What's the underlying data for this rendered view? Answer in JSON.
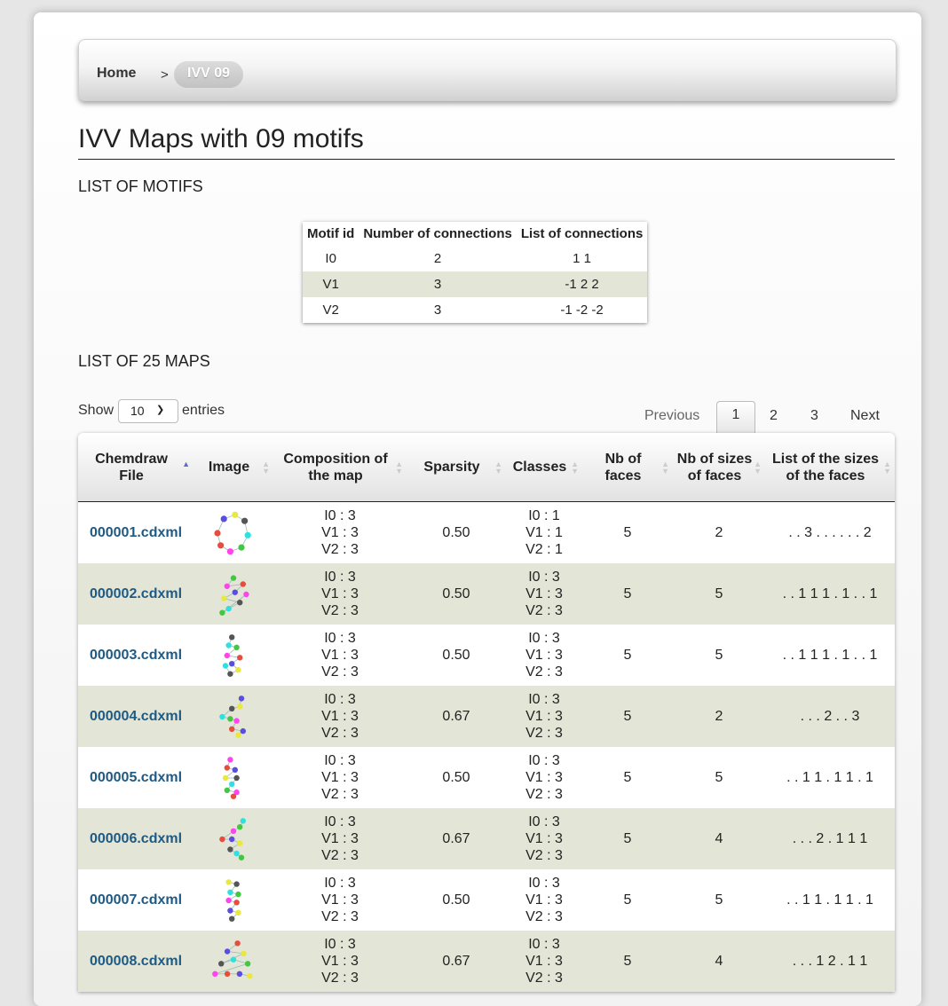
{
  "breadcrumb": {
    "home": "Home",
    "separator": ">",
    "current": "IVV 09"
  },
  "title": "IVV Maps with 09 motifs",
  "motifs_title": "LIST OF MOTIFS",
  "motif_table": {
    "headers": [
      "Motif id",
      "Number of connections",
      "List of connections"
    ],
    "rows": [
      [
        "I0",
        "2",
        "1 1"
      ],
      [
        "V1",
        "3",
        "-1 2 2"
      ],
      [
        "V2",
        "3",
        "-1 -2 -2"
      ]
    ]
  },
  "maps_title": "LIST OF 25 MAPS",
  "length_control": {
    "show": "Show",
    "value": "10",
    "entries": "entries"
  },
  "pagination": {
    "previous": "Previous",
    "pages": [
      "1",
      "2",
      "3"
    ],
    "next": "Next"
  },
  "maps_table": {
    "headers": [
      "Chemdraw File",
      "Image",
      "Composition of the map",
      "Sparsity",
      "Classes",
      "Nb of faces",
      "Nb of sizes of faces",
      "List of the sizes of the faces"
    ],
    "rows": [
      {
        "file": "000001.cdxml",
        "image": "molecule-ring-icon",
        "composition": [
          "I0 : 3",
          "V1 : 3",
          "V2 : 3"
        ],
        "sparsity": "0.50",
        "classes": [
          "I0 : 1",
          "V1 : 1",
          "V2 : 1"
        ],
        "faces": "5",
        "sizes": "2",
        "list": ". . 3 . . . . . . 2"
      },
      {
        "file": "000002.cdxml",
        "image": "molecule-graph-icon",
        "composition": [
          "I0 : 3",
          "V1 : 3",
          "V2 : 3"
        ],
        "sparsity": "0.50",
        "classes": [
          "I0 : 3",
          "V1 : 3",
          "V2 : 3"
        ],
        "faces": "5",
        "sizes": "5",
        "list": ". . 1 1 1 . 1 . . 1"
      },
      {
        "file": "000003.cdxml",
        "image": "molecule-graph-icon",
        "composition": [
          "I0 : 3",
          "V1 : 3",
          "V2 : 3"
        ],
        "sparsity": "0.50",
        "classes": [
          "I0 : 3",
          "V1 : 3",
          "V2 : 3"
        ],
        "faces": "5",
        "sizes": "5",
        "list": ". . 1 1 1 . 1 . . 1"
      },
      {
        "file": "000004.cdxml",
        "image": "molecule-graph-icon",
        "composition": [
          "I0 : 3",
          "V1 : 3",
          "V2 : 3"
        ],
        "sparsity": "0.67",
        "classes": [
          "I0 : 3",
          "V1 : 3",
          "V2 : 3"
        ],
        "faces": "5",
        "sizes": "2",
        "list": ". . . 2 . . 3"
      },
      {
        "file": "000005.cdxml",
        "image": "molecule-graph-icon",
        "composition": [
          "I0 : 3",
          "V1 : 3",
          "V2 : 3"
        ],
        "sparsity": "0.50",
        "classes": [
          "I0 : 3",
          "V1 : 3",
          "V2 : 3"
        ],
        "faces": "5",
        "sizes": "5",
        "list": ". . 1 1 . 1 1 . 1"
      },
      {
        "file": "000006.cdxml",
        "image": "molecule-graph-icon",
        "composition": [
          "I0 : 3",
          "V1 : 3",
          "V2 : 3"
        ],
        "sparsity": "0.67",
        "classes": [
          "I0 : 3",
          "V1 : 3",
          "V2 : 3"
        ],
        "faces": "5",
        "sizes": "4",
        "list": ". . . 2 . 1 1 1"
      },
      {
        "file": "000007.cdxml",
        "image": "molecule-graph-icon",
        "composition": [
          "I0 : 3",
          "V1 : 3",
          "V2 : 3"
        ],
        "sparsity": "0.50",
        "classes": [
          "I0 : 3",
          "V1 : 3",
          "V2 : 3"
        ],
        "faces": "5",
        "sizes": "5",
        "list": ". . 1 1 . 1 1 . 1"
      },
      {
        "file": "000008.cdxml",
        "image": "molecule-graph-icon",
        "composition": [
          "I0 : 3",
          "V1 : 3",
          "V2 : 3"
        ],
        "sparsity": "0.67",
        "classes": [
          "I0 : 3",
          "V1 : 3",
          "V2 : 3"
        ],
        "faces": "5",
        "sizes": "4",
        "list": ". . . 1 2 . 1 1"
      }
    ]
  },
  "colors": {
    "link": "#1f5a84",
    "stripe": "#e3e6d6",
    "sort_active": "#6666cc"
  }
}
